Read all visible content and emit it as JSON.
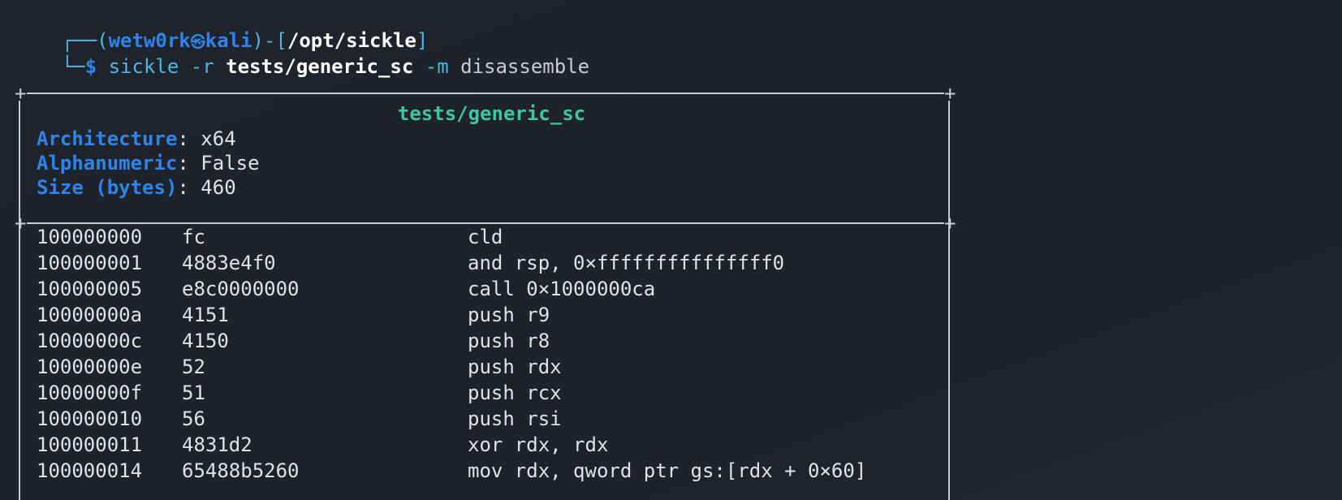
{
  "prompt": {
    "corner_top": "┌──(",
    "user": "wetw0rk",
    "host_symbol": "㉿",
    "host": "kali",
    "sep": ")-[",
    "cwd": "/opt/sickle",
    "close": "]",
    "corner_bottom": "└─",
    "dollar": "$",
    "cmd": "sickle",
    "flag_r": "-r",
    "arg_r": "tests/generic_sc",
    "flag_m": "-m",
    "arg_m": "disassemble"
  },
  "info": {
    "title": "tests/generic_sc",
    "fields": [
      {
        "label": "Architecture",
        "value": "x64"
      },
      {
        "label": "Alphanumeric",
        "value": "False"
      },
      {
        "label": "Size (bytes)",
        "value": "460"
      }
    ]
  },
  "disasm": [
    {
      "addr": "100000000",
      "bytes": "fc",
      "instr": "cld"
    },
    {
      "addr": "100000001",
      "bytes": "4883e4f0",
      "instr": "and rsp, 0×fffffffffffffff0"
    },
    {
      "addr": "100000005",
      "bytes": "e8c0000000",
      "instr": "call 0×1000000ca"
    },
    {
      "addr": "10000000a",
      "bytes": "4151",
      "instr": "push r9"
    },
    {
      "addr": "10000000c",
      "bytes": "4150",
      "instr": "push r8"
    },
    {
      "addr": "10000000e",
      "bytes": "52",
      "instr": "push rdx"
    },
    {
      "addr": "10000000f",
      "bytes": "51",
      "instr": "push rcx"
    },
    {
      "addr": "100000010",
      "bytes": "56",
      "instr": "push rsi"
    },
    {
      "addr": "100000011",
      "bytes": "4831d2",
      "instr": "xor rdx, rdx"
    },
    {
      "addr": "100000014",
      "bytes": "65488b5260",
      "instr": "mov rdx, qword ptr gs:[rdx + 0×60]"
    }
  ],
  "colors": {
    "background": "#1f232c",
    "prompt_blue": "#2f84ea",
    "command_cyan": "#4fb6e0",
    "title_green": "#3ec6a4",
    "text": "#dfe2e8"
  }
}
